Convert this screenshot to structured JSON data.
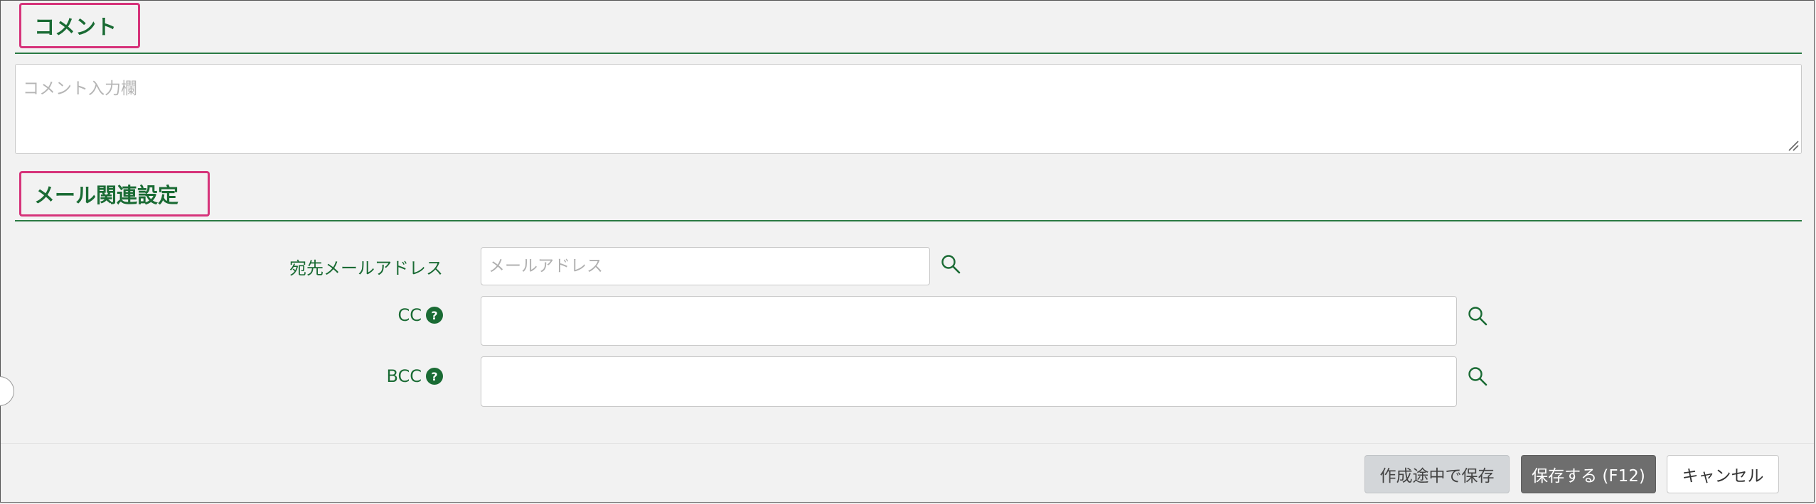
{
  "comment_section": {
    "title": "コメント",
    "placeholder": "コメント入力欄",
    "value": ""
  },
  "mail_section": {
    "title": "メール関連設定",
    "to": {
      "label": "宛先メールアドレス",
      "placeholder": "メールアドレス",
      "value": ""
    },
    "cc": {
      "label": "CC",
      "help": "?",
      "value": ""
    },
    "bcc": {
      "label": "BCC",
      "help": "?",
      "value": ""
    },
    "search_icon": "search-icon"
  },
  "footer": {
    "draft_label": "作成途中で保存",
    "save_label": "保存する (F12)",
    "cancel_label": "キャンセル"
  },
  "colors": {
    "accent": "#1a6b34",
    "highlight_border": "#d6337a",
    "save_button": "#6e6e6e",
    "draft_button": "#d3d6d9"
  }
}
